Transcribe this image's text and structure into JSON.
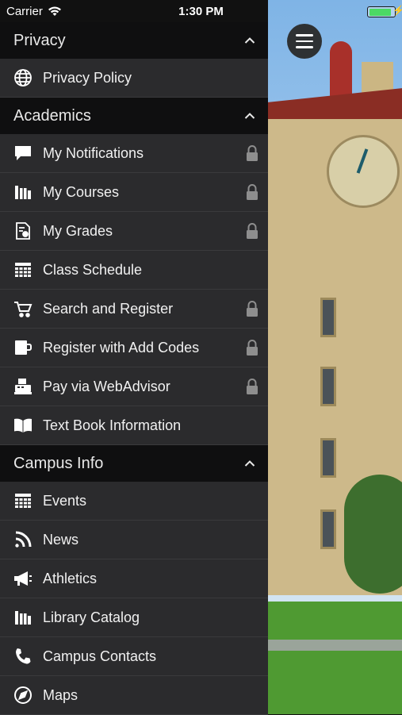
{
  "status_bar": {
    "carrier": "Carrier",
    "time": "1:30 PM"
  },
  "menu": {
    "sections": [
      {
        "title": "Privacy",
        "items": [
          {
            "label": "Privacy Policy",
            "icon": "globe-icon",
            "locked": false
          }
        ]
      },
      {
        "title": "Academics",
        "items": [
          {
            "label": "My Notifications",
            "icon": "chat-bubble-icon",
            "locked": true
          },
          {
            "label": "My Courses",
            "icon": "books-icon",
            "locked": true
          },
          {
            "label": "My Grades",
            "icon": "grade-report-icon",
            "locked": true
          },
          {
            "label": "Class Schedule",
            "icon": "calendar-grid-icon",
            "locked": false
          },
          {
            "label": "Search and Register",
            "icon": "cart-icon",
            "locked": true
          },
          {
            "label": "Register with Add Codes",
            "icon": "coffee-cup-icon",
            "locked": true
          },
          {
            "label": "Pay via WebAdvisor",
            "icon": "cash-register-icon",
            "locked": true
          },
          {
            "label": "Text Book Information",
            "icon": "open-book-icon",
            "locked": false
          }
        ]
      },
      {
        "title": "Campus Info",
        "items": [
          {
            "label": "Events",
            "icon": "calendar-grid-icon",
            "locked": false
          },
          {
            "label": "News",
            "icon": "rss-icon",
            "locked": false
          },
          {
            "label": "Athletics",
            "icon": "megaphone-icon",
            "locked": false
          },
          {
            "label": "Library Catalog",
            "icon": "books-icon",
            "locked": false
          },
          {
            "label": "Campus Contacts",
            "icon": "phone-icon",
            "locked": false
          },
          {
            "label": "Maps",
            "icon": "compass-icon",
            "locked": false
          }
        ]
      }
    ]
  },
  "colors": {
    "drawer_bg": "#2b2b2d",
    "section_bg": "#0f0f10",
    "text": "#f1f1f1",
    "lock": "#8e8e8e"
  }
}
